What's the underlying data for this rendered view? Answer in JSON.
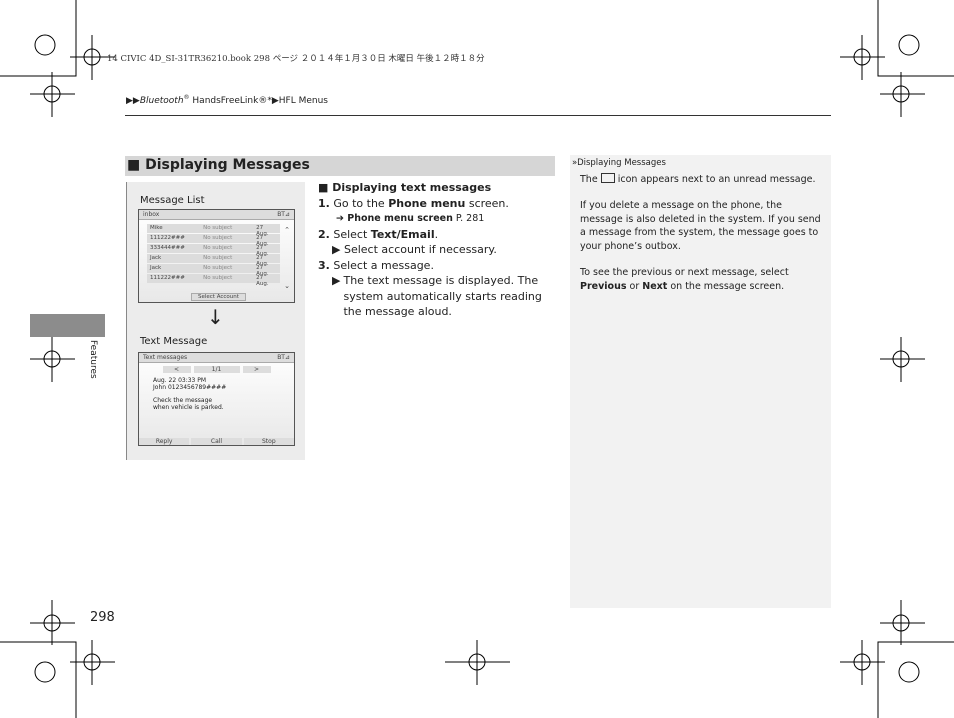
{
  "print_line": "14 CIVIC 4D_SI-31TR36210.book  298 ページ  ２０１４年１月３０日  木曜日  午後１２時１８分",
  "breadcrumb": {
    "arrows": "▶▶",
    "item1": "Bluetooth",
    "reg1": "®",
    "item2": " HandsFreeLink®*",
    "sep": "▶",
    "item3": "HFL Menus"
  },
  "section": {
    "marker": "■",
    "title": "Displaying Messages"
  },
  "figure": {
    "list_caption": "Message List",
    "list_screen": {
      "title": "inbox",
      "status": "BT⊿",
      "rows": [
        {
          "name": "Mike",
          "subject": "No subject",
          "date": "27 Aug."
        },
        {
          "name": "111222###",
          "subject": "No subject",
          "date": "27 Aug."
        },
        {
          "name": "333444###",
          "subject": "No subject",
          "date": "27 Aug."
        },
        {
          "name": "Jack",
          "subject": "No subject",
          "date": "27 Aug."
        },
        {
          "name": "Jack",
          "subject": "No subject",
          "date": "27 Aug."
        },
        {
          "name": "111222###",
          "subject": "No subject",
          "date": "27 Aug."
        }
      ],
      "button": "Select Account"
    },
    "arrow": "↓",
    "msg_caption": "Text Message",
    "msg_screen": {
      "title": "Text messages",
      "status": "BT⊿",
      "prev": "<",
      "page": "1/1",
      "next": ">",
      "date": "Aug. 22 03:33 PM",
      "from": "John 0123456789####",
      "body1": "Check the message",
      "body2": "when vehicle is parked.",
      "buttons": [
        "Reply",
        "Call",
        "Stop"
      ]
    }
  },
  "steps": {
    "heading": "Displaying text messages",
    "s1_num": "1.",
    "s1_a": "Go to the ",
    "s1_b": "Phone menu",
    "s1_c": " screen.",
    "s1_ref": "Phone menu screen",
    "s1_ref_page": " P. 281",
    "s2_num": "2.",
    "s2_a": "Select ",
    "s2_b": "Text/Email",
    "s2_c": ".",
    "s2_sub": "Select account if necessary.",
    "s3_num": "3.",
    "s3_a": "Select a message.",
    "s3_sub": "The text message is displayed. The system automatically starts reading the message aloud."
  },
  "sidebar_note": {
    "title": "Displaying Messages",
    "p1a": "The ",
    "p1b": " icon appears next to an unread message.",
    "p2": "If you delete a message on the phone, the message is also deleted in the system. If you send a message from the system, the message goes to your phone’s outbox.",
    "p3a": "To see the previous or next message, select ",
    "p3b": "Previous",
    "p3c": " or ",
    "p3d": "Next",
    "p3e": " on the message screen."
  },
  "chapter_tab": "Features",
  "page_number": "298"
}
